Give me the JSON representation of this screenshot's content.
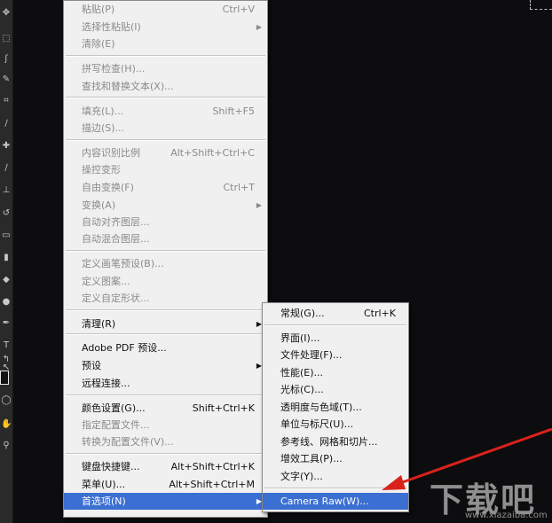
{
  "toolbar": {
    "tools": [
      "move-icon",
      "marquee-icon",
      "lasso-icon",
      "quick-select-icon",
      "crop-icon",
      "eyedropper-icon",
      "healing-brush-icon",
      "brush-icon",
      "clone-stamp-icon",
      "history-brush-icon",
      "eraser-icon",
      "gradient-icon",
      "blur-icon",
      "dodge-icon",
      "pen-icon",
      "type-icon",
      "path-select-icon",
      "shape-icon",
      "hand-icon",
      "zoom-icon",
      "swap-colors-icon"
    ],
    "tool_glyphs": [
      "✥",
      "⬚",
      "ʃ",
      "✎",
      "⌗",
      "∕",
      "✚",
      "∕",
      "⊥",
      "↺",
      "▭",
      "▮",
      "◆",
      "●",
      "✒",
      "T",
      "↖",
      "◯",
      "✋",
      "⚲",
      "↰"
    ]
  },
  "edit_menu": {
    "items": [
      {
        "label": "粘贴(P)",
        "shortcut": "Ctrl+V",
        "disabled": true
      },
      {
        "label": "选择性粘贴(I)",
        "submenu": true,
        "disabled": true
      },
      {
        "label": "清除(E)",
        "disabled": true
      },
      {
        "separator": true
      },
      {
        "label": "拼写检查(H)...",
        "disabled": true
      },
      {
        "label": "查找和替换文本(X)...",
        "disabled": true
      },
      {
        "separator": true
      },
      {
        "label": "填充(L)...",
        "shortcut": "Shift+F5",
        "disabled": true
      },
      {
        "label": "描边(S)...",
        "disabled": true
      },
      {
        "separator": true
      },
      {
        "label": "内容识别比例",
        "shortcut": "Alt+Shift+Ctrl+C",
        "disabled": true
      },
      {
        "label": "操控变形",
        "disabled": true
      },
      {
        "label": "自由变换(F)",
        "shortcut": "Ctrl+T",
        "disabled": true
      },
      {
        "label": "变换(A)",
        "submenu": true,
        "disabled": true
      },
      {
        "label": "自动对齐图层...",
        "disabled": true
      },
      {
        "label": "自动混合图层...",
        "disabled": true
      },
      {
        "separator": true
      },
      {
        "label": "定义画笔预设(B)...",
        "disabled": true
      },
      {
        "label": "定义图案...",
        "disabled": true
      },
      {
        "label": "定义自定形状...",
        "disabled": true
      },
      {
        "separator": true
      },
      {
        "label": "清理(R)",
        "submenu": true
      },
      {
        "separator": true
      },
      {
        "label": "Adobe PDF 预设..."
      },
      {
        "label": "预设",
        "submenu": true
      },
      {
        "label": "远程连接..."
      },
      {
        "separator": true
      },
      {
        "label": "颜色设置(G)...",
        "shortcut": "Shift+Ctrl+K"
      },
      {
        "label": "指定配置文件...",
        "disabled": true
      },
      {
        "label": "转换为配置文件(V)...",
        "disabled": true
      },
      {
        "separator": true
      },
      {
        "label": "键盘快捷键...",
        "shortcut": "Alt+Shift+Ctrl+K"
      },
      {
        "label": "菜单(U)...",
        "shortcut": "Alt+Shift+Ctrl+M"
      },
      {
        "label": "首选项(N)",
        "submenu": true,
        "selected": true
      }
    ]
  },
  "preferences_submenu": {
    "items": [
      {
        "label": "常规(G)...",
        "shortcut": "Ctrl+K"
      },
      {
        "separator": true
      },
      {
        "label": "界面(I)..."
      },
      {
        "label": "文件处理(F)..."
      },
      {
        "label": "性能(E)..."
      },
      {
        "label": "光标(C)..."
      },
      {
        "label": "透明度与色域(T)..."
      },
      {
        "label": "单位与标尺(U)..."
      },
      {
        "label": "参考线、网格和切片..."
      },
      {
        "label": "增效工具(P)..."
      },
      {
        "label": "文字(Y)..."
      },
      {
        "separator": true
      },
      {
        "label": "Camera Raw(W)...",
        "selected": true
      }
    ]
  },
  "watermark": {
    "text": "下载吧",
    "url": "www.xiazaiba.com"
  },
  "colors": {
    "menu_bg": "#f0f0f0",
    "highlight": "#3b6fd1",
    "annotation_arrow": "#d9221b",
    "canvas": "#0d0c0e"
  }
}
